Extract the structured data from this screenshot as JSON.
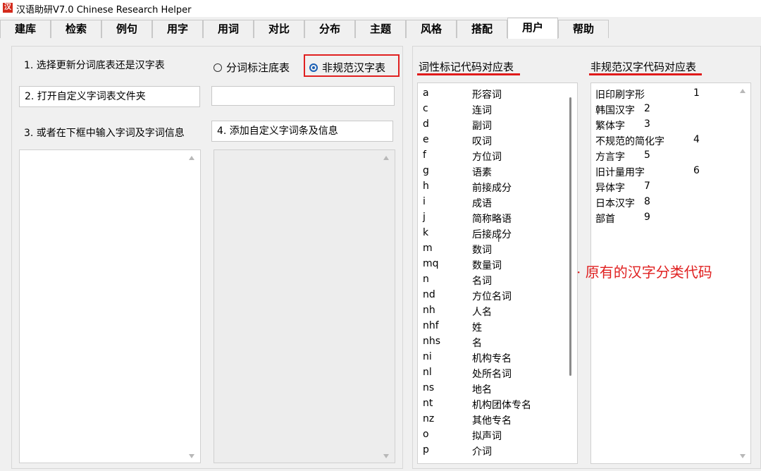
{
  "window": {
    "title": "汉语助研V7.0  Chinese Research Helper",
    "icon_text": "汉"
  },
  "menu": {
    "tabs": [
      "建库",
      "检索",
      "例句",
      "用字",
      "用词",
      "对比",
      "分布",
      "主题",
      "风格",
      "搭配",
      "用户",
      "帮助"
    ],
    "active_tab": "用户"
  },
  "left": {
    "step1_label": "1.  选择更新分词底表还是汉字表",
    "radio_option1": "分词标注底表",
    "radio_option2": "非规范汉字表",
    "radio_selected": "非规范汉字表",
    "step2_button": "2.  打开自定义字词表文件夹",
    "folder_path_value": "",
    "step3_label": "3.  或者在下框中输入字词及字词信息",
    "step4_button": "4.  添加自定义字词条及信息"
  },
  "pos_table": {
    "title": "词性标记代码对应表",
    "rows": [
      {
        "code": "a",
        "name": "形容词"
      },
      {
        "code": "c",
        "name": "连词"
      },
      {
        "code": "d",
        "name": "副词"
      },
      {
        "code": "e",
        "name": "叹词"
      },
      {
        "code": "f",
        "name": "方位词"
      },
      {
        "code": "g",
        "name": "语素"
      },
      {
        "code": "h",
        "name": "前接成分"
      },
      {
        "code": "i",
        "name": "成语"
      },
      {
        "code": "j",
        "name": "简称略语"
      },
      {
        "code": "k",
        "name": "后接成分"
      },
      {
        "code": "m",
        "name": "数词"
      },
      {
        "code": "mq",
        "name": "数量词"
      },
      {
        "code": "n",
        "name": "名词"
      },
      {
        "code": "nd",
        "name": "方位名词"
      },
      {
        "code": "nh",
        "name": "人名"
      },
      {
        "code": "nhf",
        "name": "姓"
      },
      {
        "code": "nhs",
        "name": "名"
      },
      {
        "code": "ni",
        "name": "机构专名"
      },
      {
        "code": "nl",
        "name": "处所名词"
      },
      {
        "code": "ns",
        "name": "地名"
      },
      {
        "code": "nt",
        "name": "机构团体专名"
      },
      {
        "code": "nz",
        "name": "其他专名"
      },
      {
        "code": "o",
        "name": "拟声词"
      },
      {
        "code": "p",
        "name": "介词"
      }
    ]
  },
  "char_table": {
    "title": "非规范汉字代码对应表",
    "rows": [
      {
        "name": "旧印刷字形",
        "code": "1"
      },
      {
        "name": "韩国汉字",
        "code": "2"
      },
      {
        "name": "繁体字",
        "code": "3"
      },
      {
        "name": "不规范的简化字",
        "code": "4"
      },
      {
        "name": "方言字",
        "code": "5"
      },
      {
        "name": "旧计量用字",
        "code": "6"
      },
      {
        "name": "异体字",
        "code": "7"
      },
      {
        "name": "日本汉字",
        "code": "8"
      },
      {
        "name": "部首",
        "code": "9"
      }
    ]
  },
  "annotation": {
    "text": "· 原有的汉字分类代码",
    "color": "#e02020"
  },
  "colors": {
    "highlight": "#e02020",
    "radio_accent": "#1a5fb4"
  }
}
